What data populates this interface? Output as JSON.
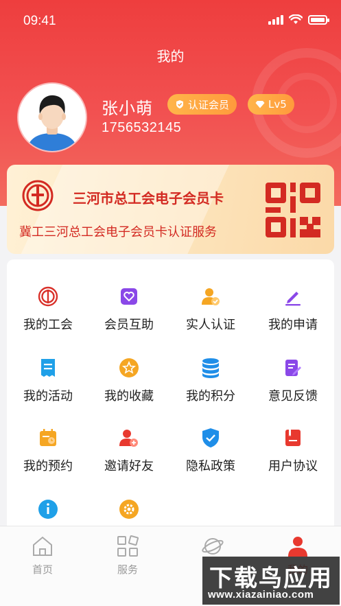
{
  "status_bar": {
    "time": "09:41"
  },
  "header": {
    "title": "我的"
  },
  "profile": {
    "name": "张小萌",
    "phone": "1756532145",
    "badges": {
      "certified": "认证会员",
      "level": "Lv5"
    }
  },
  "member_card": {
    "title": "三河市总工会电子会员卡",
    "subtitle": "冀工三河总工会电子会员卡认证服务"
  },
  "menu": {
    "items": [
      {
        "label": "我的工会",
        "icon": "union-emblem-icon"
      },
      {
        "label": "会员互助",
        "icon": "heart-box-icon"
      },
      {
        "label": "实人认证",
        "icon": "verified-user-icon"
      },
      {
        "label": "我的申请",
        "icon": "edit-pen-icon"
      },
      {
        "label": "我的活动",
        "icon": "receipt-icon"
      },
      {
        "label": "我的收藏",
        "icon": "star-icon"
      },
      {
        "label": "我的积分",
        "icon": "coin-stack-icon"
      },
      {
        "label": "意见反馈",
        "icon": "feedback-doc-icon"
      },
      {
        "label": "我的预约",
        "icon": "calendar-clock-icon"
      },
      {
        "label": "邀请好友",
        "icon": "invite-user-icon"
      },
      {
        "label": "隐私政策",
        "icon": "shield-check-icon"
      },
      {
        "label": "用户协议",
        "icon": "agreement-book-icon"
      },
      {
        "label": "",
        "icon": "info-icon"
      },
      {
        "label": "",
        "icon": "settings-gear-icon"
      }
    ]
  },
  "tabbar": {
    "tabs": [
      {
        "label": "首页"
      },
      {
        "label": "服务"
      },
      {
        "label": ""
      },
      {
        "label": "我的"
      }
    ]
  },
  "watermark": {
    "main": "下载鸟应用",
    "url": "www.xiazainiao.com"
  },
  "colors": {
    "primary": "#ee3e3e",
    "badge": "#ff9a3c",
    "card_text": "#d32a22"
  }
}
